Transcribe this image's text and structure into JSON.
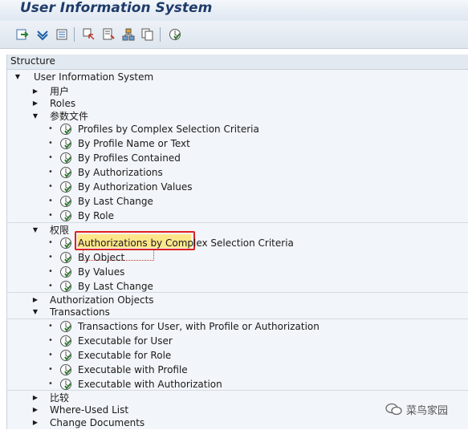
{
  "app": {
    "title": "User Information System"
  },
  "toolbar": {
    "buttons": [
      {
        "name": "execute-icon",
        "color": "#2e7d32"
      },
      {
        "name": "expand-subtree-icon",
        "color": "#1f5fa8"
      },
      {
        "name": "collapse-subtree-icon",
        "color": "#1f5fa8"
      },
      {
        "name": "select-icon",
        "color": "#555555"
      },
      {
        "name": "find-icon",
        "color": "#555555"
      },
      {
        "name": "hierarchy-icon",
        "color": "#555555"
      },
      {
        "name": "copy-icon",
        "color": "#555555"
      },
      {
        "name": "variant-icon",
        "color": "#2e7d32"
      }
    ]
  },
  "structure": {
    "header": "Structure",
    "root": "User Information System",
    "nodes": {
      "users": "用户",
      "roles": "Roles",
      "profiles": {
        "label": "参数文件",
        "items": [
          "Profiles by Complex Selection Criteria",
          "By Profile Name or Text",
          "By Profiles Contained",
          "By Authorizations",
          "By Authorization Values",
          "By Last Change",
          "By Role"
        ]
      },
      "authorizations": {
        "label": "权限",
        "items": [
          "Authorizations by Complex Selection Criteria",
          "By Object",
          "By Values",
          "By Last Change"
        ]
      },
      "auth_objects": "Authorization Objects",
      "transactions": {
        "label": "Transactions",
        "items": [
          "Transactions for User, with Profile or Authorization",
          "Executable for User",
          "Executable for Role",
          "Executable with Profile",
          "Executable with Authorization"
        ]
      },
      "comparisons": "比较",
      "where_used": "Where-Used List",
      "change_docs": "Change Documents"
    }
  },
  "highlight": {
    "selected_item": "By Authorization Values",
    "color": "#e02020"
  },
  "watermark": {
    "text": "菜鸟家园"
  }
}
